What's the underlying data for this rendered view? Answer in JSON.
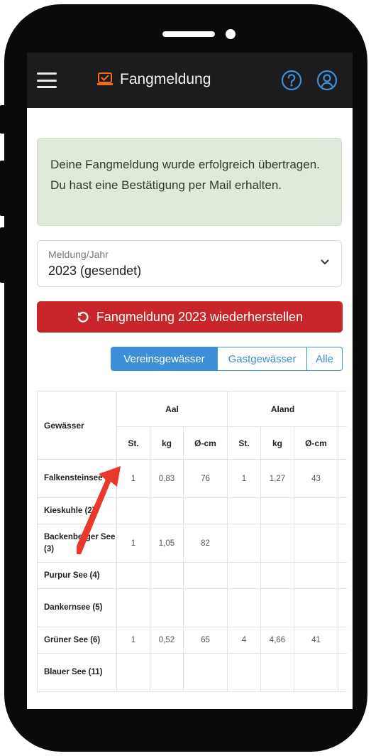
{
  "header": {
    "title": "Fangmeldung",
    "help_icon": "question-circle-icon",
    "user_icon": "user-circle-icon",
    "menu_icon": "hamburger-menu-icon",
    "title_icon": "report-checklist-icon",
    "accent_color": "#f26b21"
  },
  "alert": {
    "message": "Deine Fangmeldung wurde erfolgreich übertragen. Du hast eine Bestätigung per Mail erhalten."
  },
  "select": {
    "label": "Meldung/Jahr",
    "value": "2023 (gesendet)"
  },
  "restore_button": {
    "label": "Fangmeldung 2023 wiederherstellen",
    "color": "#c8262b"
  },
  "segments": {
    "items": [
      "Vereinsgewässer",
      "Gastgewässer",
      "Alle"
    ],
    "active": "Vereinsgewässer",
    "color": "#3d8fd6"
  },
  "table": {
    "waters_header": "Gewässer",
    "species": [
      "Aal",
      "Aland"
    ],
    "subheaders": [
      "St.",
      "kg",
      "Ø-cm"
    ],
    "rows": [
      {
        "name": "Falkensteinsee (1)",
        "values": [
          "1",
          "0,83",
          "76",
          "1",
          "1,27",
          "43"
        ]
      },
      {
        "name": "Kieskuhle (2)",
        "values": [
          "",
          "",
          "",
          "",
          "",
          ""
        ]
      },
      {
        "name": "Backenberger See (3)",
        "values": [
          "1",
          "1,05",
          "82",
          "",
          "",
          ""
        ]
      },
      {
        "name": "Purpur See (4)",
        "values": [
          "",
          "",
          "",
          "",
          "",
          ""
        ]
      },
      {
        "name": "Dankernsee (5)",
        "values": [
          "",
          "",
          "",
          "",
          "",
          ""
        ]
      },
      {
        "name": "Grüner See (6)",
        "values": [
          "1",
          "0,52",
          "65",
          "4",
          "4,66",
          "41"
        ]
      },
      {
        "name": "Blauer See (11)",
        "values": [
          "",
          "",
          "",
          "",
          "",
          ""
        ]
      }
    ]
  },
  "annotation": {
    "arrow_color": "#e8392b"
  }
}
